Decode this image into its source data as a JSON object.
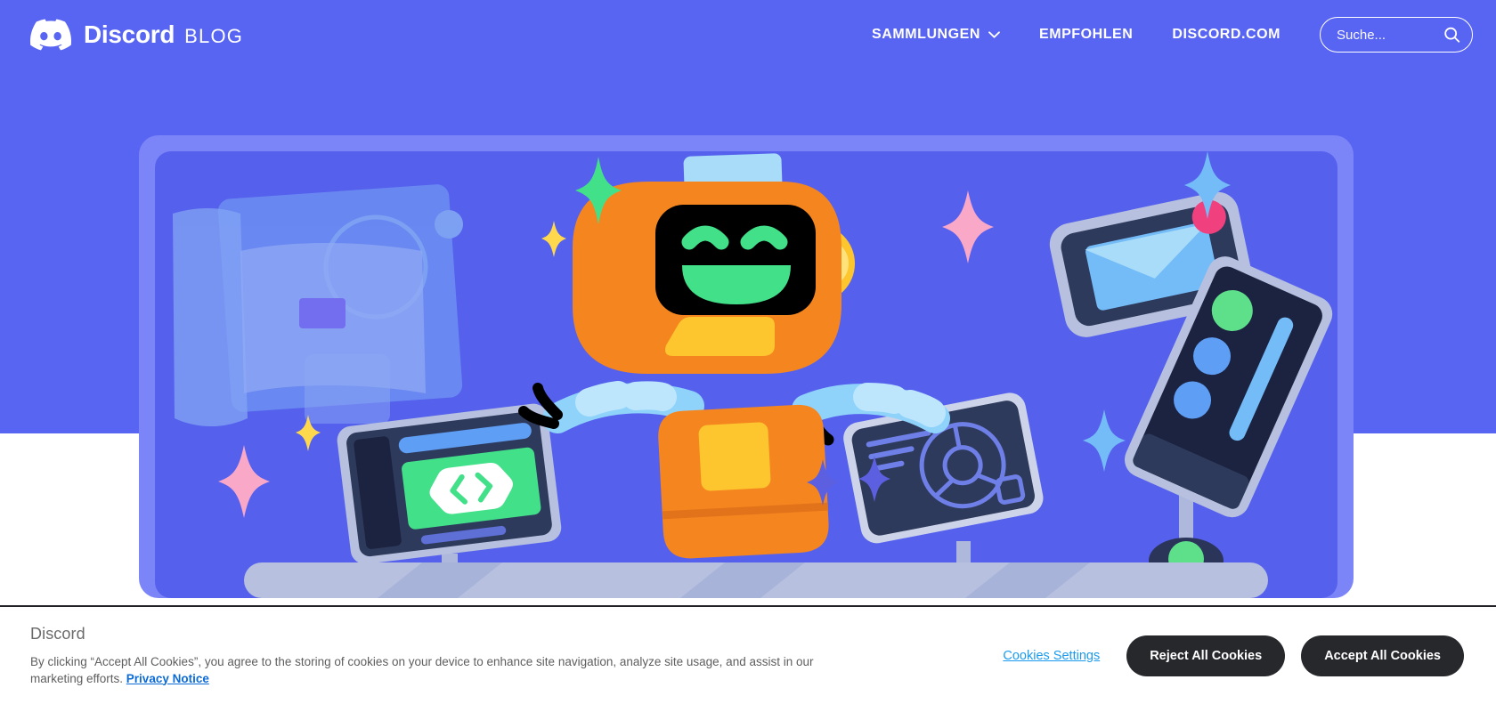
{
  "header": {
    "brand_name": "Discord",
    "brand_sub": "BLOG",
    "logo_icon": "discord-mascot-icon",
    "nav": [
      {
        "label": "SAMMLUNGEN",
        "has_chevron": true,
        "icon": "chevron-down-icon"
      },
      {
        "label": "EMPFOHLEN",
        "has_chevron": false
      },
      {
        "label": "DISCORD.COM",
        "has_chevron": false
      }
    ],
    "search": {
      "placeholder": "Suche...",
      "value": "",
      "icon": "search-icon"
    }
  },
  "hero": {
    "alt": "Discord Wumpus robot mascot surrounded by floating screens, tablets and sparkles",
    "illustration_name": "robot-mascot-illustration",
    "elements": [
      "robot-mascot",
      "code-monitor",
      "mail-tablet",
      "chart-tablet",
      "phone-device",
      "translucent-panels",
      "sparkles"
    ]
  },
  "cookie_banner": {
    "title": "Discord",
    "body_prefix": "By clicking “Accept All Cookies”, you agree to the storing of cookies on your device to enhance site navigation, analyze site usage, and assist in our marketing efforts. ",
    "privacy_link": "Privacy Notice",
    "settings_link": "Cookies Settings",
    "reject_label": "Reject All Cookies",
    "accept_label": "Accept All Cookies"
  },
  "colors": {
    "blurple": "#5865F2",
    "hero_frame": "#7B85F7",
    "hero_panel": "#5561ED",
    "robot_orange": "#F5861F",
    "robot_orange_dark": "#E3731A",
    "robot_yellow": "#FDC62E",
    "screen_green": "#43E08A",
    "arm_blue": "#8FD3FB",
    "device_navy": "#2E3A5C",
    "device_dark": "#1B2340",
    "device_frame": "#B7C0DE",
    "sparkle_pink": "#F9A8C8",
    "sparkle_yellow": "#FFD84D",
    "sparkle_green": "#43E08A",
    "sparkle_blue": "#6FC8F7",
    "sparkle_violet": "#5B5FE0",
    "notify_pink": "#F0417E",
    "cookie_link_blue": "#1A9BF0",
    "cookie_btn_dark": "#26282C"
  }
}
